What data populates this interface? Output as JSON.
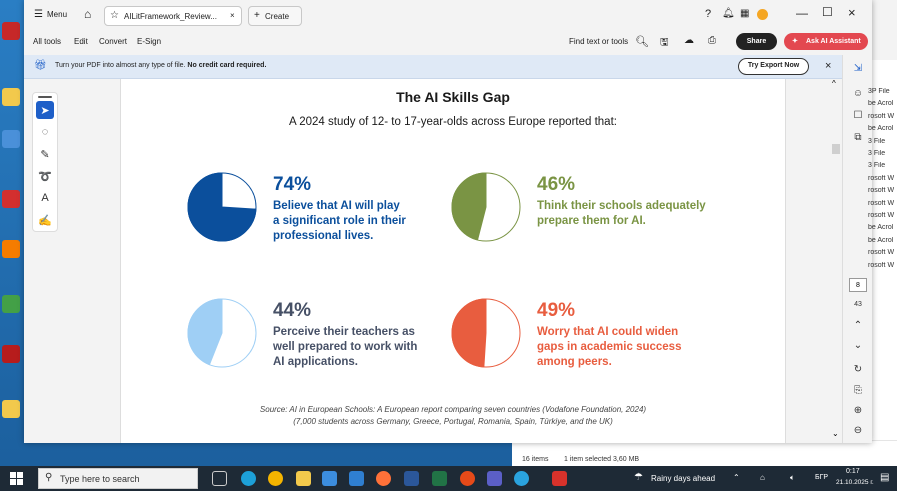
{
  "acrobat": {
    "titlebar": {
      "menu_label": "Menu",
      "doc_tab_label": "AILitFramework_Review...",
      "create_tab_label": "Create"
    },
    "menubar": {
      "items": [
        "All tools",
        "Edit",
        "Convert",
        "E-Sign"
      ],
      "find_label": "Find text or tools",
      "share_label": "Share",
      "ai_label": "Ask AI Assistant"
    },
    "promo": {
      "text_plain": "Turn your PDF into almost any type of file.",
      "text_bold": "No credit card required.",
      "button_label": "Try Export Now"
    },
    "right_rail": {
      "page_current": "8",
      "page_total": "43"
    }
  },
  "document": {
    "title": "The AI Skills Gap",
    "subtitle": "A 2024 study of 12- to 17-year-olds across Europe reported that:",
    "stats": [
      {
        "percent": "74%",
        "value": 0.74,
        "color": "#0b4f9c",
        "lines": [
          "Believe that AI will play",
          "a significant role in their",
          "professional lives."
        ]
      },
      {
        "percent": "46%",
        "value": 0.46,
        "color": "#7a9444",
        "lines": [
          "Think their schools adequately",
          "prepare them for AI."
        ]
      },
      {
        "percent": "44%",
        "value": 0.44,
        "color": "#9fcff5",
        "lines": [
          "Perceive their teachers as",
          "well prepared to work with",
          "AI applications."
        ]
      },
      {
        "percent": "49%",
        "value": 0.49,
        "color": "#e85d3f",
        "lines": [
          "Worry that AI could widen",
          "gaps in academic success",
          "among peers."
        ]
      }
    ],
    "text_color_dark": "#465066",
    "source_line1": "Source: AI in European Schools: A European report comparing seven countries (Vodafone Foundation, 2024)",
    "source_line2": "(7,000 students across Germany, Greece, Portugal, Romania, Spain, Türkiye, and the UK)"
  },
  "explorer": {
    "items": [
      "3P File",
      "be Acrol",
      "rosoft W",
      "be Acrol",
      "3 File",
      "3 File",
      "3 File",
      "rosoft W",
      "rosoft W",
      "rosoft W",
      "rosoft W",
      "be Acrol",
      "be Acrol",
      "rosoft W",
      "rosoft W"
    ],
    "status_items": "16 items",
    "status_selected": "1 item selected  3,60 MB"
  },
  "taskbar": {
    "search_placeholder": "Type here to search",
    "weather": "Rainy days ahead",
    "language": "БГР",
    "time": "0:17",
    "date": "21.10.2025 г."
  }
}
